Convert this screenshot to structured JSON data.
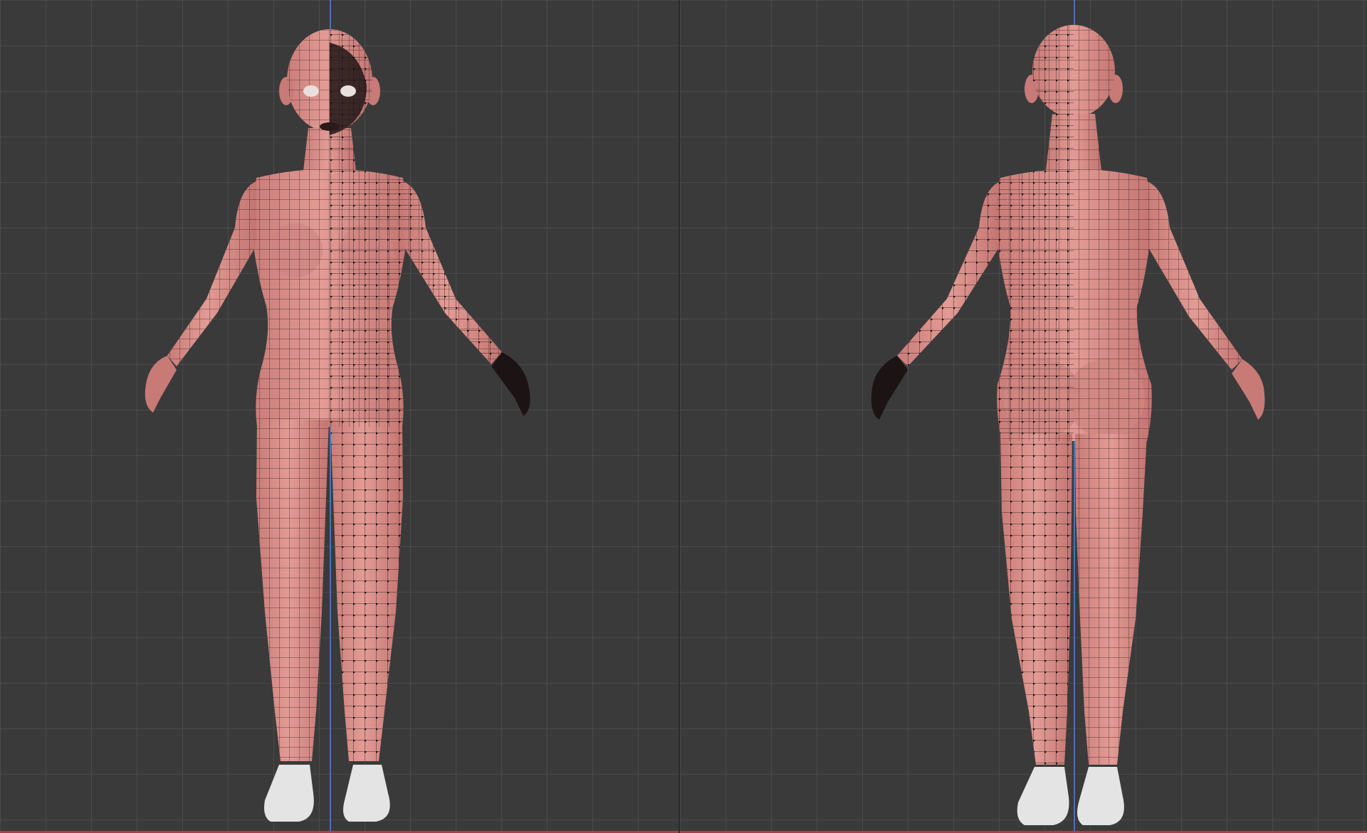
{
  "viewports": [
    {
      "id": "front",
      "view": "front",
      "figure_facing": "front"
    },
    {
      "id": "back",
      "view": "back",
      "figure_facing": "back"
    }
  ],
  "colors": {
    "background": "#3a3a3a",
    "grid": "#4a4a4a",
    "z_axis": "#4a7fc0",
    "x_axis": "#b5404e",
    "skin": "#d98f8a",
    "skin_shadow": "#b86c6a",
    "wireframe": "#1a1010",
    "vertex": "#111111",
    "shoe": "#e4e4e4"
  },
  "icons": {
    "figure": "human-mesh-icon",
    "shoe": "shoe-icon"
  }
}
